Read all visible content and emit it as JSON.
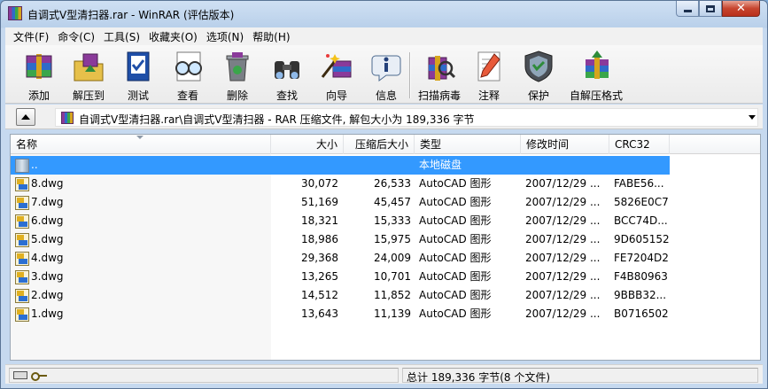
{
  "window": {
    "title": "自调式V型清扫器.rar - WinRAR (评估版本)"
  },
  "menu": [
    "文件(F)",
    "命令(C)",
    "工具(S)",
    "收藏夹(O)",
    "选项(N)",
    "帮助(H)"
  ],
  "toolbar": [
    {
      "label": "添加",
      "icon": "add-archive-icon"
    },
    {
      "label": "解压到",
      "icon": "extract-to-icon"
    },
    {
      "label": "测试",
      "icon": "test-icon"
    },
    {
      "label": "查看",
      "icon": "view-icon"
    },
    {
      "label": "删除",
      "icon": "delete-icon"
    },
    {
      "label": "查找",
      "icon": "find-icon"
    },
    {
      "label": "向导",
      "icon": "wizard-icon"
    },
    {
      "label": "信息",
      "icon": "info-icon"
    },
    {
      "label": "扫描病毒",
      "icon": "virus-scan-icon"
    },
    {
      "label": "注释",
      "icon": "comment-icon"
    },
    {
      "label": "保护",
      "icon": "protect-icon"
    },
    {
      "label": "自解压格式",
      "icon": "sfx-icon"
    }
  ],
  "address": {
    "path": "自调式V型清扫器.rar\\自调式V型清扫器 - RAR 压缩文件, 解包大小为 189,336 字节"
  },
  "columns": {
    "name": "名称",
    "size": "大小",
    "packed": "压缩后大小",
    "type": "类型",
    "modified": "修改时间",
    "crc": "CRC32"
  },
  "parent_row": {
    "name": "..",
    "type": "本地磁盘"
  },
  "files": [
    {
      "name": "8.dwg",
      "size": "30,072",
      "packed": "26,533",
      "type": "AutoCAD 图形",
      "modified": "2007/12/29 ...",
      "crc": "FABE56..."
    },
    {
      "name": "7.dwg",
      "size": "51,169",
      "packed": "45,457",
      "type": "AutoCAD 图形",
      "modified": "2007/12/29 ...",
      "crc": "5826E0C7"
    },
    {
      "name": "6.dwg",
      "size": "18,321",
      "packed": "15,333",
      "type": "AutoCAD 图形",
      "modified": "2007/12/29 ...",
      "crc": "BCC74D..."
    },
    {
      "name": "5.dwg",
      "size": "18,986",
      "packed": "15,975",
      "type": "AutoCAD 图形",
      "modified": "2007/12/29 ...",
      "crc": "9D605152"
    },
    {
      "name": "4.dwg",
      "size": "29,368",
      "packed": "24,009",
      "type": "AutoCAD 图形",
      "modified": "2007/12/29 ...",
      "crc": "FE7204D2"
    },
    {
      "name": "3.dwg",
      "size": "13,265",
      "packed": "10,701",
      "type": "AutoCAD 图形",
      "modified": "2007/12/29 ...",
      "crc": "F4B80963"
    },
    {
      "name": "2.dwg",
      "size": "14,512",
      "packed": "11,852",
      "type": "AutoCAD 图形",
      "modified": "2007/12/29 ...",
      "crc": "9BBB32..."
    },
    {
      "name": "1.dwg",
      "size": "13,643",
      "packed": "11,139",
      "type": "AutoCAD 图形",
      "modified": "2007/12/29 ...",
      "crc": "B0716502"
    }
  ],
  "status": {
    "summary": "总计 189,336 字节(8 个文件)"
  },
  "colors": {
    "selection": "#3399ff",
    "title_gradient_top": "#cfe0f3",
    "close_button": "#c7452f"
  }
}
